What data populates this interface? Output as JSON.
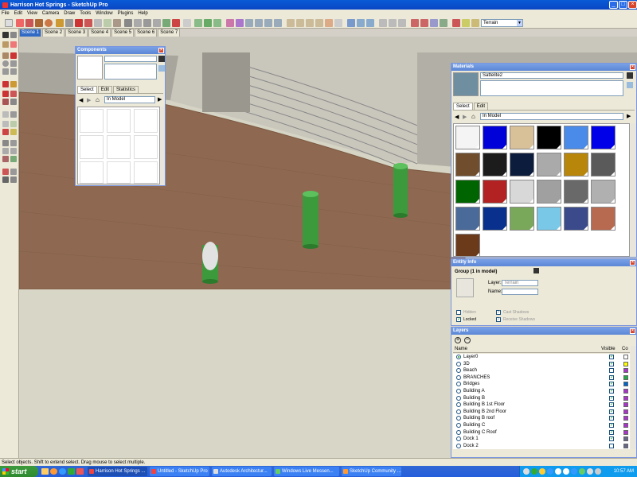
{
  "window": {
    "title": "Harrison Hot Springs - SketchUp Pro",
    "minimize": "_",
    "maximize": "□",
    "close": "×"
  },
  "menu": [
    "File",
    "Edit",
    "View",
    "Camera",
    "Draw",
    "Tools",
    "Window",
    "Plugins",
    "Help"
  ],
  "toolbar": {
    "layer_dropdown_value": "Terrain"
  },
  "scenes": [
    "Scene 1",
    "Scene 2",
    "Scene 3",
    "Scene 4",
    "Scene 5",
    "Scene 6",
    "Scene 7"
  ],
  "components": {
    "title": "Components",
    "tabs": [
      "Select",
      "Edit",
      "Statistics"
    ],
    "location": "In Model"
  },
  "materials": {
    "title": "Materials",
    "name": "Sattelite2",
    "tabs": [
      "Select",
      "Edit"
    ],
    "location": "In Model",
    "swatches": [
      "#f4f4f4",
      "#0000d8",
      "#d8c098",
      "#000000",
      "#4a8ae8",
      "#0000e8",
      "#704d2c",
      "#1c1c1c",
      "#0c1c3c",
      "#aaaaaa",
      "#b8860b",
      "#5a5a5a",
      "#006400",
      "#b22222",
      "#d8d8d8",
      "#a0a0a0",
      "#696969",
      "#b0b0b0",
      "#4a6a9a",
      "#08308c",
      "#7aa85a",
      "#7ac8e8",
      "#3a4a8a",
      "#b86a50",
      "#6a3a1a"
    ]
  },
  "entity_info": {
    "title": "Entity Info",
    "heading": "Group (1 in model)",
    "layer_label": "Layer:",
    "layer_value": "Terrain",
    "name_label": "Name:",
    "hidden": "Hidden",
    "locked": "Locked",
    "cast_shadows": "Cast Shadows",
    "receive_shadows": "Receive Shadows"
  },
  "layers": {
    "title": "Layers",
    "col_name": "Name",
    "col_visible": "Visible",
    "col_color": "Co",
    "rows": [
      {
        "name": "Layer0",
        "visible": true,
        "color": "#ffffff",
        "active": true
      },
      {
        "name": "3D",
        "visible": true,
        "color": "#ffff00",
        "active": false
      },
      {
        "name": "Beach",
        "visible": false,
        "color": "#aa33cc",
        "active": false
      },
      {
        "name": "BRANCHES",
        "visible": true,
        "color": "#22aa44",
        "active": false
      },
      {
        "name": "Bridges",
        "visible": true,
        "color": "#0066cc",
        "active": false
      },
      {
        "name": "Building A",
        "visible": true,
        "color": "#aa33cc",
        "active": false
      },
      {
        "name": "Building B",
        "visible": true,
        "color": "#aa33cc",
        "active": false
      },
      {
        "name": "Building B 1st Floor",
        "visible": true,
        "color": "#aa33cc",
        "active": false
      },
      {
        "name": "Building B 2nd Floor",
        "visible": true,
        "color": "#aa33cc",
        "active": false
      },
      {
        "name": "Building B roof",
        "visible": true,
        "color": "#aa33cc",
        "active": false
      },
      {
        "name": "Building C",
        "visible": true,
        "color": "#aa33cc",
        "active": false
      },
      {
        "name": "Building C Roof",
        "visible": true,
        "color": "#aa33cc",
        "active": false
      },
      {
        "name": "Dock 1",
        "visible": true,
        "color": "#666688",
        "active": false
      },
      {
        "name": "Dock 2",
        "visible": false,
        "color": "#666688",
        "active": false
      }
    ]
  },
  "status_text": "Select objects. Shift to extend select. Drag mouse to select multiple.",
  "taskbar": {
    "start": "start",
    "tasks": [
      "Harrison Hot Springs ...",
      "Untitled - SketchUp Pro",
      "Autodesk Architectur...",
      "Windows Live Messen...",
      "SketchUp Community ..."
    ],
    "clock": "10:57 AM"
  },
  "colors": {
    "title_blue": "#0a5ad6",
    "ground_brick": "#8e6850",
    "pillar_green": "#3c9a3c",
    "taskbar_blue": "#245edb",
    "start_green": "#2f8a2f"
  }
}
